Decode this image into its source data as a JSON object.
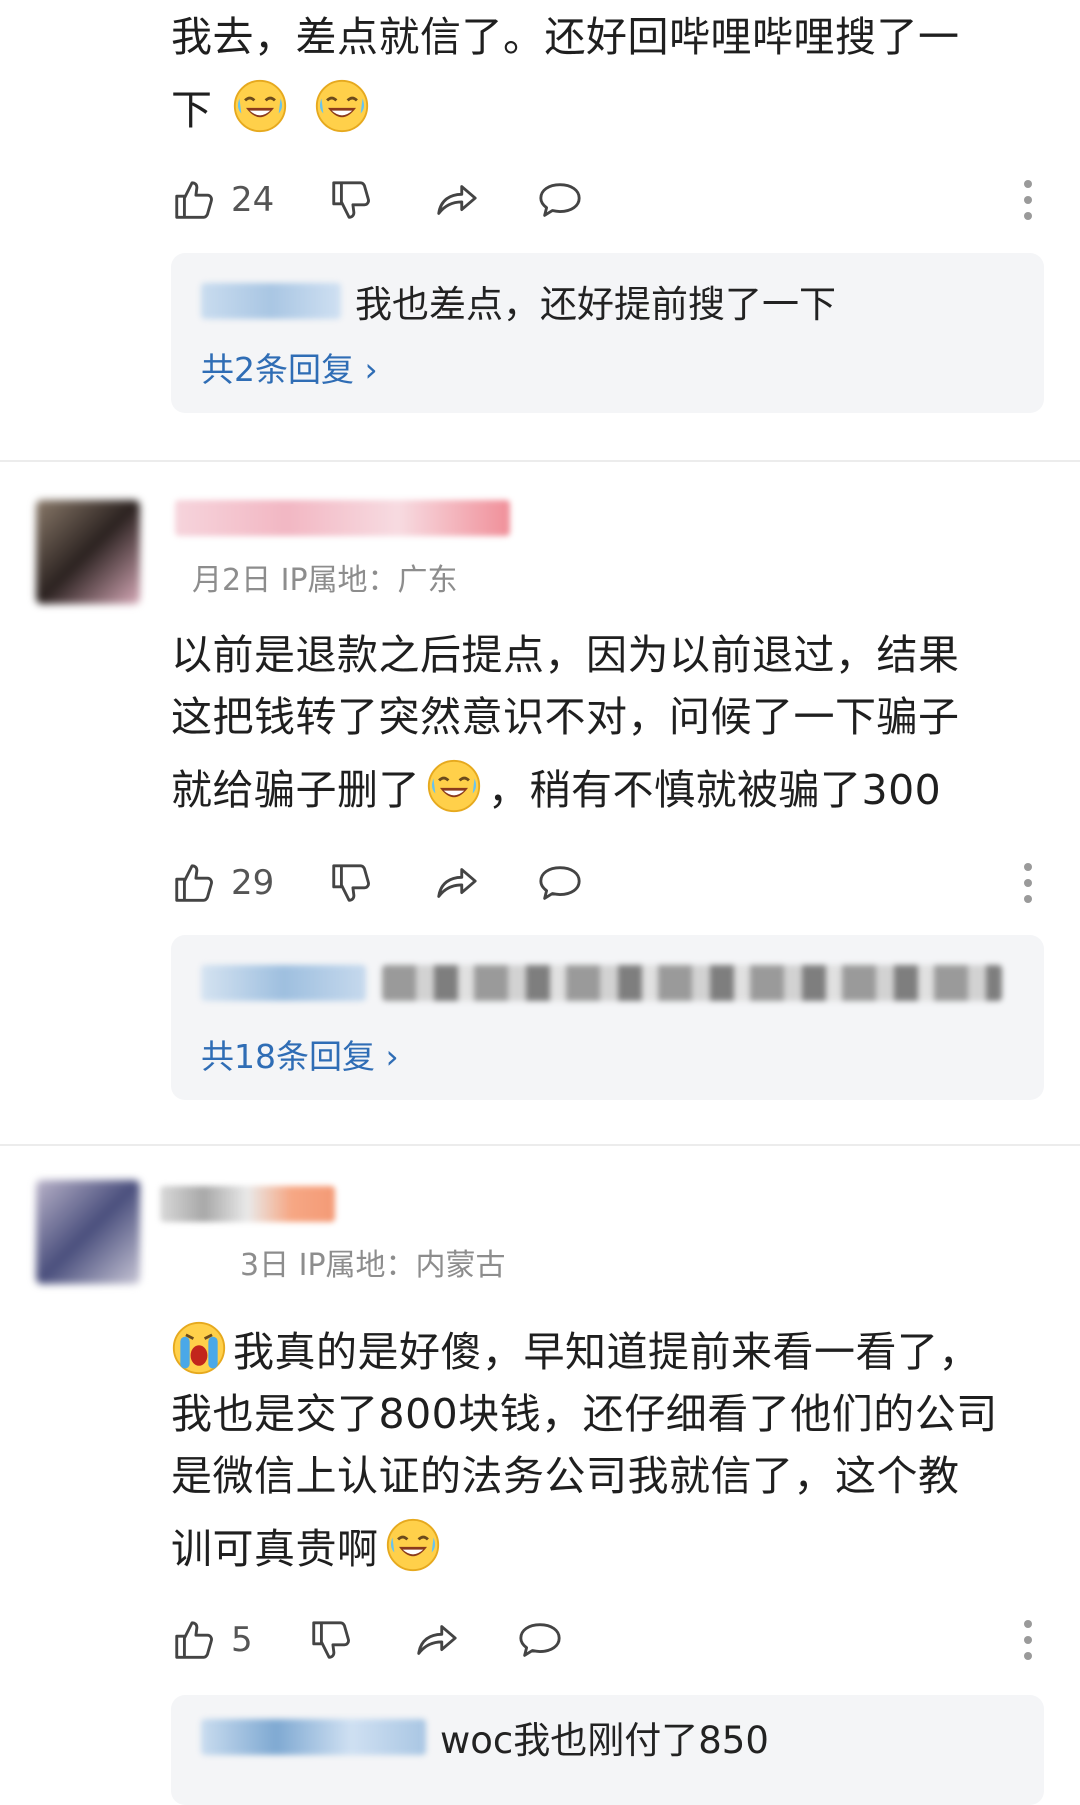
{
  "comments": [
    {
      "text_line1": "我去，差点就信了。还好回哔哩哔哩搜了一",
      "text_line2": "下",
      "likes": "24",
      "reply": {
        "text": "我也差点，还好提前搜了一下",
        "count_label": "共2条回复 ›"
      }
    },
    {
      "meta": "月2日  IP属地：广东",
      "text_line1": "以前是退款之后提点，因为以前退过，结果",
      "text_line2": "这把钱转了突然意识不对，问候了一下骗子",
      "text_line3a": "就给骗子删了",
      "text_line3b": "，稍有不慎就被骗了300",
      "likes": "29",
      "reply": {
        "count_label": "共18条回复 ›"
      }
    },
    {
      "meta": "3日  IP属地：内蒙古",
      "text_line1": "我真的是好傻，早知道提前来看一看了，",
      "text_line2": "我也是交了800块钱，还仔细看了他们的公司",
      "text_line3": "是微信上认证的法务公司我就信了，这个教",
      "text_line4": "训可真贵啊",
      "likes": "5",
      "reply": {
        "text": "woc我也刚付了850"
      }
    }
  ],
  "icons": {
    "like": "thumbs-up-icon",
    "dislike": "thumbs-down-icon",
    "share": "share-icon",
    "comment": "comment-icon",
    "more": "more-vertical-icon",
    "emoji_laugh_cry": "laugh-cry-emoji",
    "emoji_crying": "crying-emoji"
  },
  "colors": {
    "link_blue": "#2f6db5",
    "reply_bg": "#f4f5f7",
    "meta_gray": "#8d8d8d"
  }
}
